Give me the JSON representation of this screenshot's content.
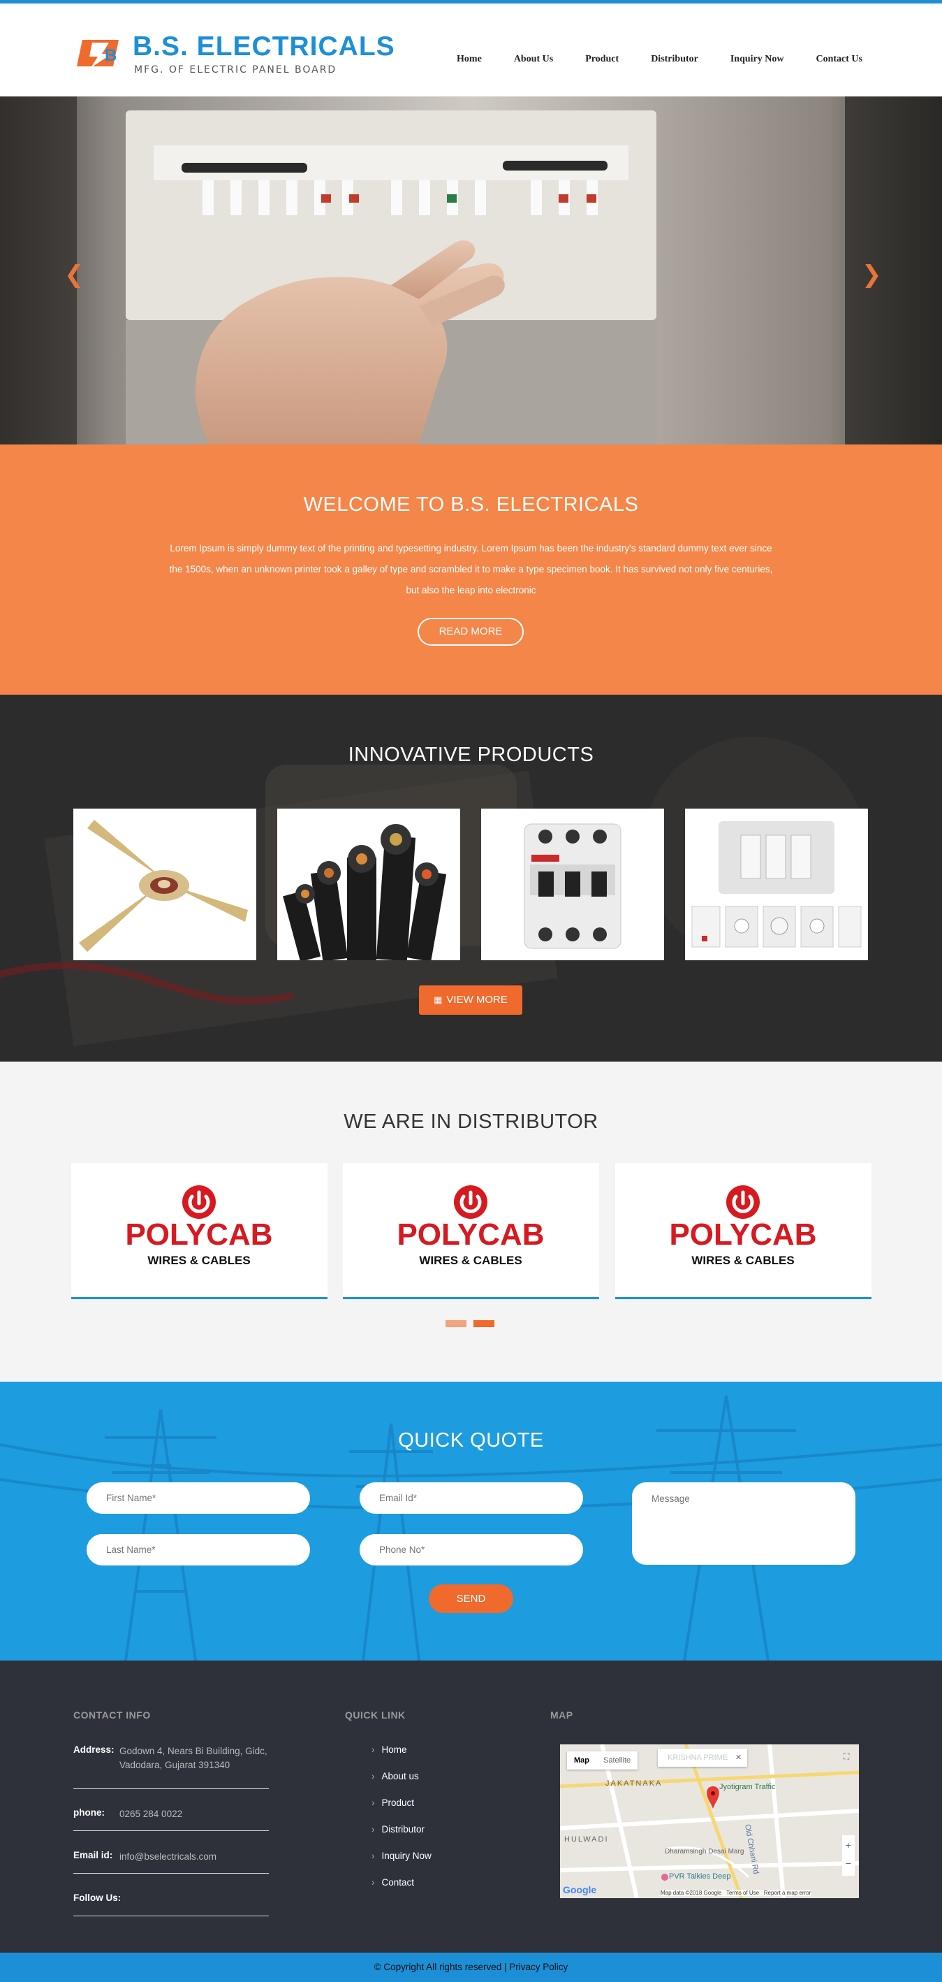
{
  "brand": {
    "name": "B.S. ELECTRICALS",
    "tagline": "MFG. OF ELECTRIC PANEL BOARD"
  },
  "nav": {
    "items": [
      {
        "label": "Home"
      },
      {
        "label": "About Us"
      },
      {
        "label": "Product"
      },
      {
        "label": "Distributor"
      },
      {
        "label": "Inquiry Now"
      },
      {
        "label": "Contact Us"
      }
    ]
  },
  "hero": {
    "prev_icon": "chevron-left-icon",
    "next_icon": "chevron-right-icon"
  },
  "welcome": {
    "title": "WELCOME TO B.S. ELECTRICALS",
    "text": "Lorem Ipsum is simply dummy text of the printing and typesetting industry. Lorem Ipsum has been the industry's standard dummy text ever since the 1500s, when an unknown printer took a galley of type and scrambled it to make a type specimen book. It has survived not only five centuries, but also the leap into electronic",
    "button": "READ MORE"
  },
  "products": {
    "title": "INNOVATIVE PRODUCTS",
    "items": [
      {
        "icon": "ceiling-fan-icon"
      },
      {
        "icon": "cables-icon"
      },
      {
        "icon": "circuit-breaker-icon"
      },
      {
        "icon": "switch-board-icon"
      }
    ],
    "button": "VIEW MORE",
    "button_icon": "grid-icon"
  },
  "distributor": {
    "title": "WE ARE IN DISTRIBUTOR",
    "cards": [
      {
        "brand": "POLYCAB",
        "sub": "WIRES & CABLES"
      },
      {
        "brand": "POLYCAB",
        "sub": "WIRES & CABLES"
      },
      {
        "brand": "POLYCAB",
        "sub": "WIRES & CABLES"
      }
    ],
    "dot_colors": [
      "#f2a37f",
      "#ef6a2c"
    ]
  },
  "quote": {
    "title": "QUICK QUOTE",
    "first_name": "First Name*",
    "last_name": "Last Name*",
    "email": "Email Id*",
    "phone": "Phone No*",
    "message": "Message",
    "send": "SEND"
  },
  "footer": {
    "contact_heading": "CONTACT INFO",
    "address_label": "Address:",
    "address_value": "Godown 4, Nears Bi Building, Gidc, Vadodara, Gujarat 391340",
    "phone_label": "phone:",
    "phone_value": "0265 284 0022",
    "email_label": "Email id:",
    "email_value": "info@bselectricals.com",
    "follow_label": "Follow Us:",
    "quick_heading": "QUICK LINK",
    "quick_links": [
      "Home",
      "About us",
      "Product",
      "Distributor",
      "Inquiry Now",
      "Contact"
    ],
    "map_heading": "MAP",
    "map": {
      "tab_map": "Map",
      "tab_satellite": "Satellite",
      "place": "KRISHNA PRIME",
      "label_1": "Jyotigram Traffic",
      "label_2": "PVR Talkies Deep",
      "label_3": "Dharamsingh Desai Marg",
      "label_4": "JAKATNAKA",
      "label_5": "HULWADI",
      "label_6": "Old Chhani Rd",
      "attribution": "Map data ©2018 Google",
      "terms": "Terms of Use",
      "report": "Report a map error",
      "google": "Google"
    }
  },
  "copyright": {
    "text": "© Copyright All rights reserved |",
    "link": "Privacy Policy"
  },
  "colors": {
    "primary_blue": "#1d8fd6",
    "orange": "#f4864a",
    "orange_dark": "#ef6a2c",
    "dark": "#2b2b2c",
    "footer": "#2e3139"
  }
}
